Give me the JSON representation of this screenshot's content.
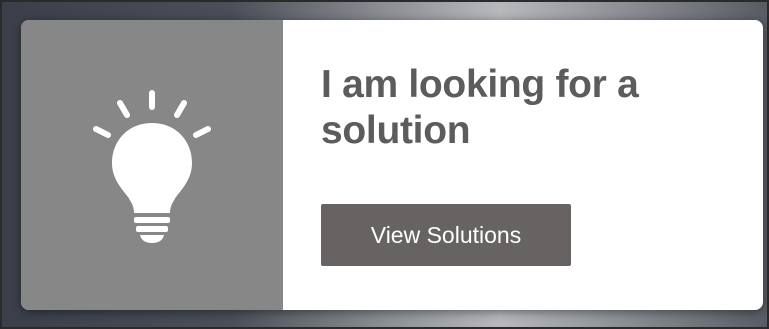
{
  "card": {
    "headline": "I am looking for a solution",
    "button_label": "View Solutions",
    "icon": "lightbulb-icon",
    "icon_panel_color": "#878787",
    "button_color": "#666362",
    "headline_color": "#5c5c5c"
  }
}
